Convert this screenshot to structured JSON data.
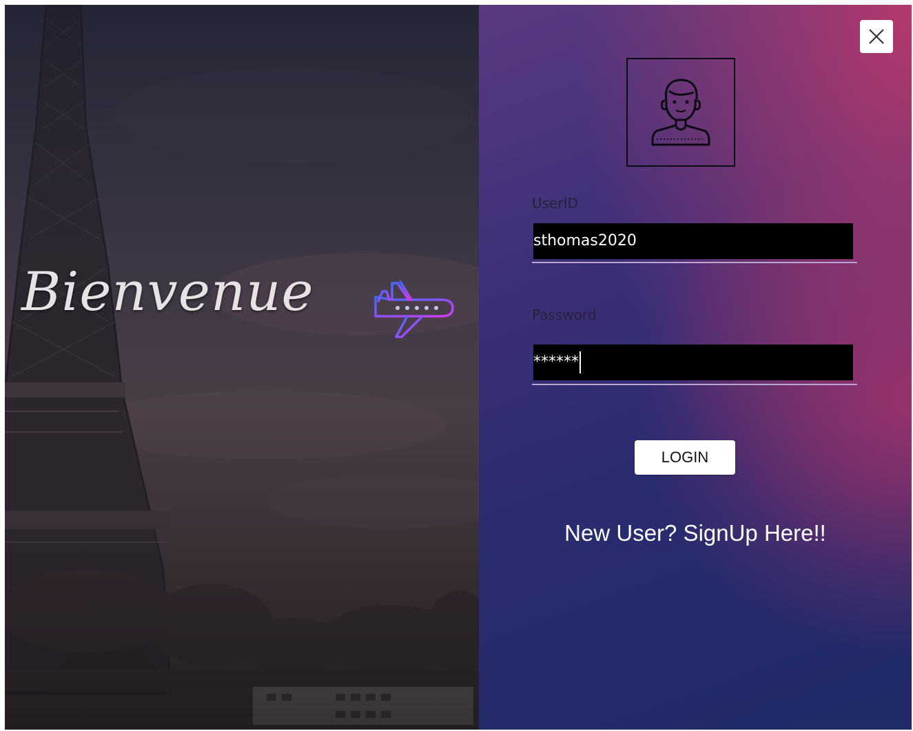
{
  "welcome": {
    "text": "Bienvenue",
    "icon": "airplane-icon"
  },
  "login": {
    "close_icon": "close-icon",
    "avatar_icon": "user-avatar-icon",
    "userid_label": "UserID",
    "userid_value": "sthomas2020",
    "password_label": "Password",
    "password_value": "******",
    "login_label": "LOGIN",
    "signup_label": "New User? SignUp Here!!"
  },
  "colors": {
    "plane_gradient_start": "#3b6cff",
    "plane_gradient_end": "#d23cf0",
    "input_bg": "#000000",
    "panel_top_right": "#b4396c",
    "panel_bottom": "#1f2a66"
  }
}
